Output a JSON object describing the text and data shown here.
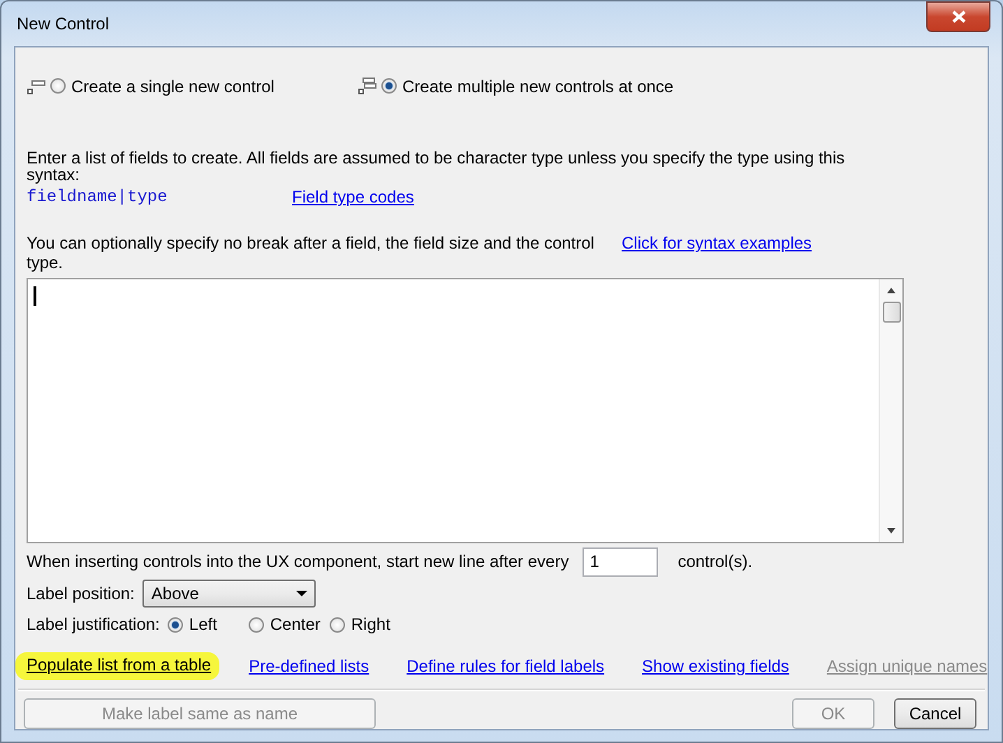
{
  "window": {
    "title": "New Control"
  },
  "modes": [
    {
      "label": "Create a single new control",
      "selected": false,
      "kind": "single"
    },
    {
      "label": "Create multiple new controls at once",
      "selected": true,
      "kind": "multiple"
    }
  ],
  "instructions": "Enter a list of fields to create. All fields are assumed to be character type unless you specify the type using this syntax:",
  "syntax": "fieldname|type",
  "type_codes_link": "Field type codes",
  "note": "You can optionally specify no break after a field, the field size and the control type.",
  "examples_link": "Click for syntax examples",
  "line_break": {
    "label": "When inserting controls into the UX component, start new line after every",
    "value": "1",
    "suffix": "control(s)."
  },
  "label_position": {
    "label": "Label position:",
    "value": "Above"
  },
  "label_justification": {
    "label": "Label justification:",
    "options": [
      {
        "label": "Left",
        "selected": true
      },
      {
        "label": "Center",
        "selected": false
      },
      {
        "label": "Right",
        "selected": false
      }
    ]
  },
  "links": [
    {
      "label": "Populate list from a table",
      "highlighted": true,
      "disabled": false
    },
    {
      "label": "Pre-defined lists",
      "highlighted": false,
      "disabled": false
    },
    {
      "label": "Define rules for field labels",
      "highlighted": false,
      "disabled": false
    },
    {
      "label": "Show existing fields",
      "highlighted": false,
      "disabled": false
    },
    {
      "label": "Assign unique names",
      "highlighted": false,
      "disabled": true
    }
  ],
  "buttons": [
    {
      "label": "Make label same as name",
      "disabled": true,
      "kind": "wide"
    },
    {
      "label": "OK",
      "disabled": true,
      "kind": "small"
    },
    {
      "label": "Cancel",
      "disabled": false,
      "kind": "small"
    }
  ]
}
